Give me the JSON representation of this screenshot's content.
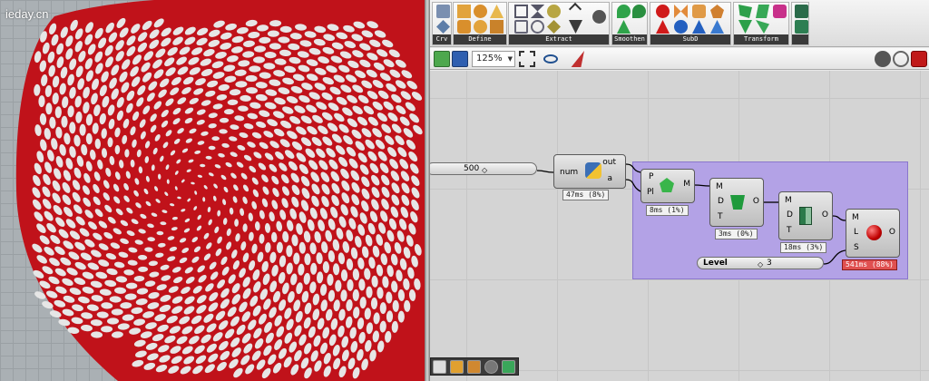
{
  "watermark": "ieday.cn",
  "ribbon": {
    "groups": [
      {
        "label": "Crv"
      },
      {
        "label": "Define"
      },
      {
        "label": "Extract"
      },
      {
        "label": "Smoothen"
      },
      {
        "label": "SubD"
      },
      {
        "label": "Transform"
      }
    ]
  },
  "toolbar": {
    "zoom": "125%"
  },
  "canvas": {
    "number_slider": {
      "value": "500"
    },
    "python": {
      "in": "num",
      "out_top": "out",
      "out_bottom": "a",
      "timing": "47ms (8%)"
    },
    "comp1": {
      "in1": "P",
      "in2": "Pl",
      "out": "M",
      "timing": "8ms (1%)"
    },
    "comp2": {
      "in1": "M",
      "in2": "D",
      "in3": "T",
      "out": "O",
      "timing": "3ms (0%)"
    },
    "comp3": {
      "in1": "M",
      "in2": "D",
      "in3": "T",
      "out": "O",
      "timing": "18ms (3%)"
    },
    "comp4": {
      "in1": "M",
      "in2": "L",
      "in3": "S",
      "out": "O",
      "timing": "541ms (88%)"
    },
    "level_slider": {
      "label": "Level",
      "value": "3"
    }
  },
  "colors": {
    "mesh_red": "#c0121a",
    "group_purple": "#b3a2e6",
    "hot_timing": "#e05050"
  }
}
